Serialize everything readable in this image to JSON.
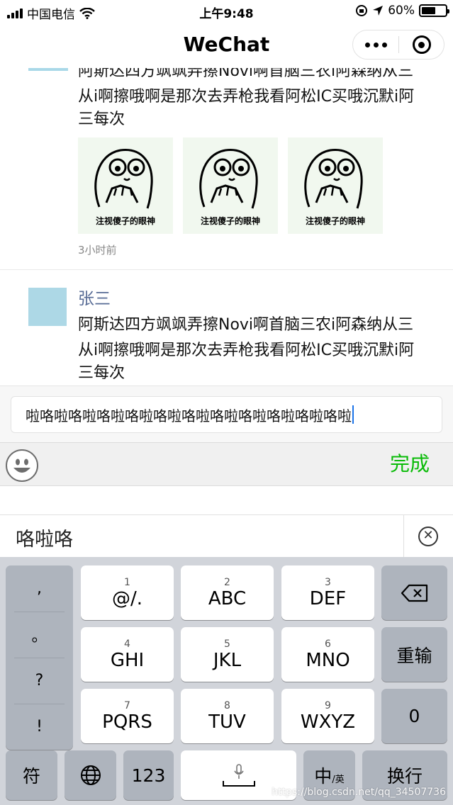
{
  "status_bar": {
    "carrier": "中国电信",
    "time": "上午9:48",
    "battery_text": "60%",
    "battery_level_percent": 60
  },
  "nav": {
    "title": "WeChat"
  },
  "feed": {
    "post_1": {
      "text_line_1": "阿斯达四方飒飒弄擦Novi啊首脑三农i阿森纳从三",
      "text_line_2": "从i啊擦哦啊是那次去弄枪我看阿松IC买哦沉默i阿",
      "text_line_3": "三每次",
      "images": [
        {
          "caption": "注视傻子的眼神"
        },
        {
          "caption": "注视傻子的眼神"
        },
        {
          "caption": "注视傻子的眼神"
        }
      ],
      "time": "3小时前"
    },
    "post_2": {
      "user_name": "张三",
      "text_line_1": "阿斯达四方飒飒弄擦Novi啊首脑三农i阿森纳从三",
      "text_line_2": "从i啊擦哦啊是那次去弄枪我看阿松IC买哦沉默i阿",
      "text_line_3": "三每次"
    }
  },
  "comment_input": {
    "value": "啦咯啦咯啦咯啦咯啦咯啦咯啦咯啦咯啦咯啦咯啦咯啦"
  },
  "toolbar": {
    "done_label": "完成"
  },
  "ime": {
    "candidate": "咯啦咯",
    "punctuation": [
      ",",
      "。",
      "?",
      "!"
    ],
    "keys_row1": [
      {
        "num": "1",
        "label": "@/."
      },
      {
        "num": "2",
        "label": "ABC"
      },
      {
        "num": "3",
        "label": "DEF"
      }
    ],
    "keys_row2": [
      {
        "num": "4",
        "label": "GHI"
      },
      {
        "num": "5",
        "label": "JKL"
      },
      {
        "num": "6",
        "label": "MNO"
      }
    ],
    "keys_row3": [
      {
        "num": "7",
        "label": "PQRS"
      },
      {
        "num": "8",
        "label": "TUV"
      },
      {
        "num": "9",
        "label": "WXYZ"
      }
    ],
    "retype_label": "重输",
    "zero_label": "0",
    "symbol_label": "符",
    "numbers_label": "123",
    "lang_main": "中",
    "lang_sub": "/英",
    "return_label": "换行",
    "watermark": "https://blog.csdn.net/qq_34507736"
  }
}
